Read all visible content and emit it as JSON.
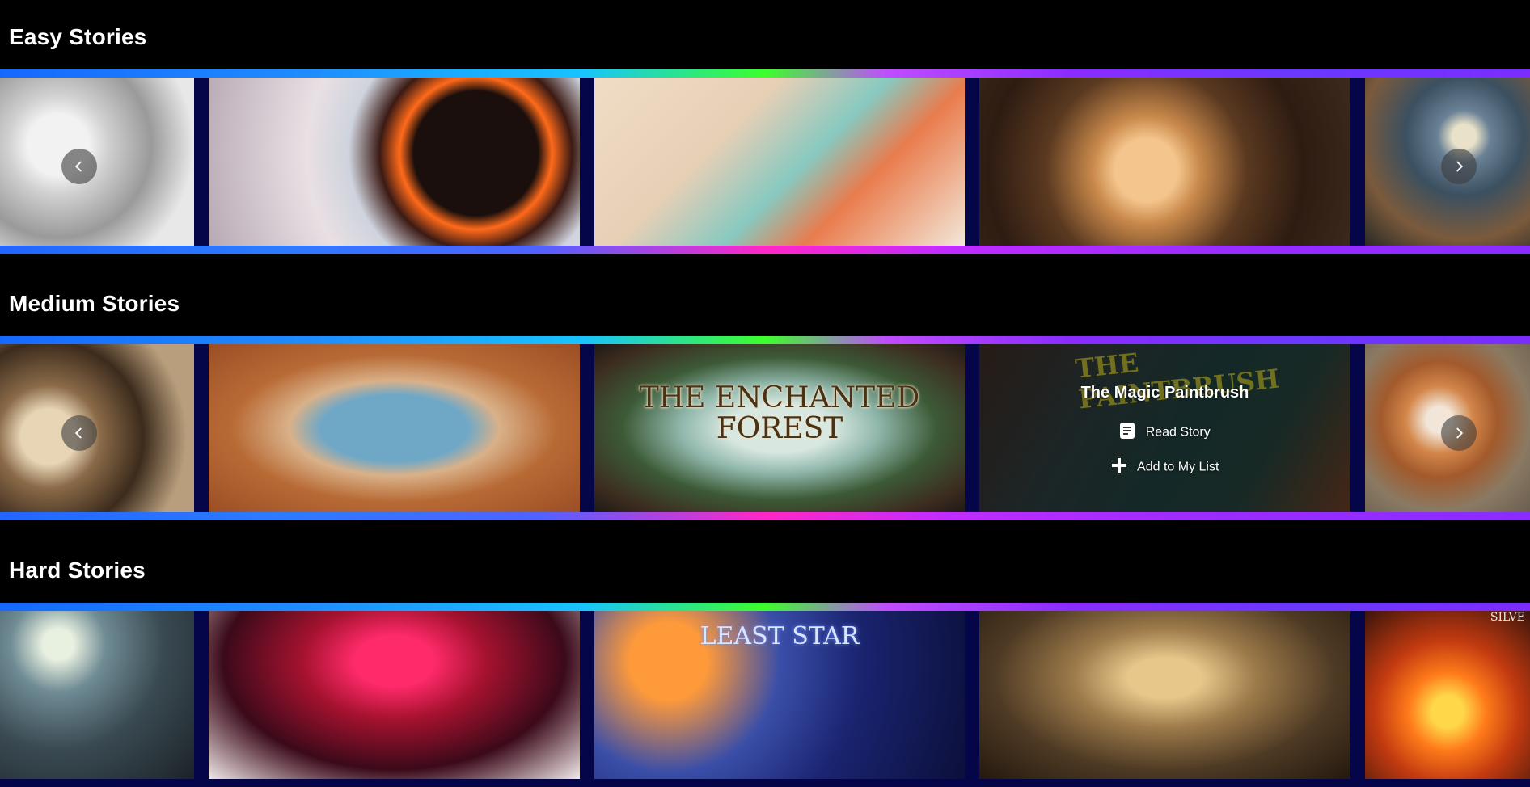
{
  "sections": [
    {
      "id": "easy",
      "title": "Easy Stories"
    },
    {
      "id": "medium",
      "title": "Medium Stories",
      "forest_cover_text": "THE ENCHANTED FOREST",
      "paintbrush_cover_text": "THE PAINTBRUSH",
      "hover_card": {
        "title": "The Magic Paintbrush",
        "read_label": "Read Story",
        "add_label": "Add to My List"
      }
    },
    {
      "id": "hard",
      "title": "Hard Stories",
      "space_cover_text": "LEAST STAR",
      "fire_cover_text": "SILVE"
    }
  ],
  "icons": {
    "prev": "chevron-left-icon",
    "next": "chevron-right-icon",
    "read": "book-icon",
    "add": "plus-icon"
  },
  "colors": {
    "background": "#000000",
    "carousel_bg": "#05054a",
    "accent_blue": "#1669ff",
    "accent_green": "#3cff2a",
    "accent_magenta": "#ff27c8",
    "accent_purple": "#8a2cff"
  }
}
